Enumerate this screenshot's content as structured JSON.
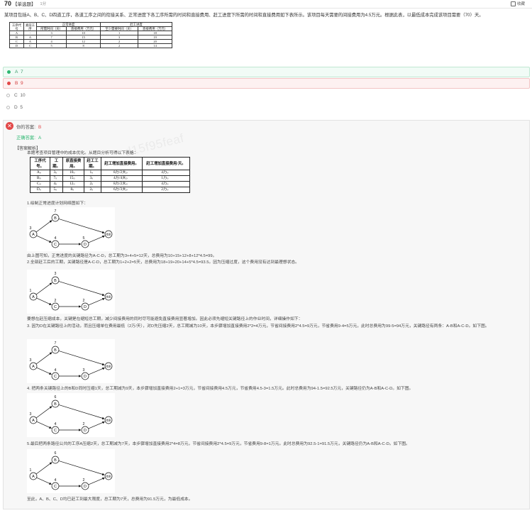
{
  "header": {
    "number": "70",
    "type": "【单选题】",
    "score": "1分",
    "collect": "收藏"
  },
  "question": {
    "stem": "某项目包括A、B、C、D四道工序，各道工序之间的衔接关系、正常进度下各工序所需的时间和直接费用、赶工进度下所需的时间和直接费用如下表所示。该项目每天需要的间接费用为4.5万元。根据此表，以最低成本完成该项目需要（70）天。",
    "table": {
      "h_code": "工序代号",
      "h_prev": "紧前工序",
      "h_normal": "正常进度",
      "h_crash": "赶工进度",
      "h_time": "所需时间（天）",
      "h_cost": "直接费用（万元）",
      "h_min": "至少需要时间（天）",
      "h_cost2": "直接费用（万元）",
      "rows": [
        [
          "A",
          "-",
          "3",
          "10",
          "1",
          "18"
        ],
        [
          "B",
          "A",
          "7",
          "15",
          "3",
          "19"
        ],
        [
          "C",
          "A",
          "4",
          "12",
          "2",
          "20"
        ],
        [
          "D",
          "C",
          "5",
          "8",
          "2",
          "14"
        ]
      ]
    }
  },
  "options": [
    {
      "letter": "A",
      "text": "7"
    },
    {
      "letter": "B",
      "text": "9"
    },
    {
      "letter": "C",
      "text": "10"
    },
    {
      "letter": "D",
      "text": "5"
    }
  ],
  "answer": {
    "mine_label": "你的答案:",
    "mine": "B",
    "correct_label": "正确答案:",
    "correct": "A",
    "watermark": "d15f95feaf",
    "analysis_label": "【答案解析】",
    "intro": "本题考查项目管理中的成本优化。从题目分析可得以下表格：",
    "table": {
      "h": [
        "工序代号。",
        "工期。",
        "原直接费用。",
        "赶工工期。",
        "赶工增加直接费用。",
        "赶工增加直接费用/天。"
      ],
      "rows": [
        [
          "A。",
          "3。",
          "10。",
          "1。",
          "8万/2天。",
          "4万。"
        ],
        [
          "B。",
          "7。",
          "15。",
          "3。",
          "4万/4天。",
          "1万。"
        ],
        [
          "C。",
          "4。",
          "12。",
          "2。",
          "8万/2天。",
          "4万。"
        ],
        [
          "D。",
          "5。",
          "8。",
          "2。",
          "6万/3天。",
          "2万。"
        ]
      ]
    },
    "p1": "1.绘制正常进度计划网络图如下：",
    "p2": "由上图可知，正常进度的关键路径为A-C-D，总工期为3+4+5=12天，总费用为10+15+12+8+12*4.5=99。",
    "p3": "2.全部赶工后的工期，关键路径是A-C-D，总工期为1+2+2=5天，总费用为18+19+20+14+5*4.5=93.5。因为压缩过度，这个费用没有达到最理想状态。",
    "p4": "要想在赶压缩成本，关键是在缩短总工期，减少间接费用的同时尽可能避免直接费用显著增加。因此必须先缩短关键路径上的作业时间，详细操作如下：",
    "p5": "3. 因为D在关键路径上的活动，而且压缩单位费用最低（2万/天），对D先压缩2天，总工期减为10天，本步骤增加直接费用2*2=4万元，节省间接费用2*4.5=9万元，节省费用9-4=5万元，此时总费用为99-5=94万元，关键路径有两条：A-B和A-C-D。如下图。",
    "p6": "4. 把两条关键路径上的B和D同时压缩1天，总工期减为9天，本步骤增加直接费用2+1=3万元，节省间接费用4.5万元，节省费用4.5-3=1.5万元。此时总费用为94-1.5=92.5万元，关键路径仍为A-B和A-C-D。如下图。",
    "p7": "5.最后把两条路径公共的工序A压缩2天，总工期减为7天，本步骤增加直接费用2*4=8万元，节省间接费用2*4.5=9万元，节省费用9-8=1万元。此时总费用为92.5-1=91.5万元，关键路径仍为A-B和A-C-D。如下图。",
    "p8": "至此，A、B、C、D均已赶工到最大限度，总工期为7天，总费用为91.5万元，为最低成本。",
    "diagram_node_a": "A",
    "diagram_node_b": "B",
    "diagram_node_c": "C",
    "diagram_node_d": "D",
    "diagram_node_end": "结束",
    "diagrams": [
      {
        "a": "3",
        "b": "7",
        "c": "4",
        "d": "5"
      },
      {
        "a": "1",
        "b": "3",
        "c": "2",
        "d": "2"
      },
      {
        "a": "3",
        "b": "7",
        "c": "4",
        "d": "3"
      },
      {
        "a": "3",
        "b": "6",
        "c": "4",
        "d": "2"
      },
      {
        "a": "1",
        "b": "6",
        "c": "4",
        "d": "2"
      }
    ]
  }
}
